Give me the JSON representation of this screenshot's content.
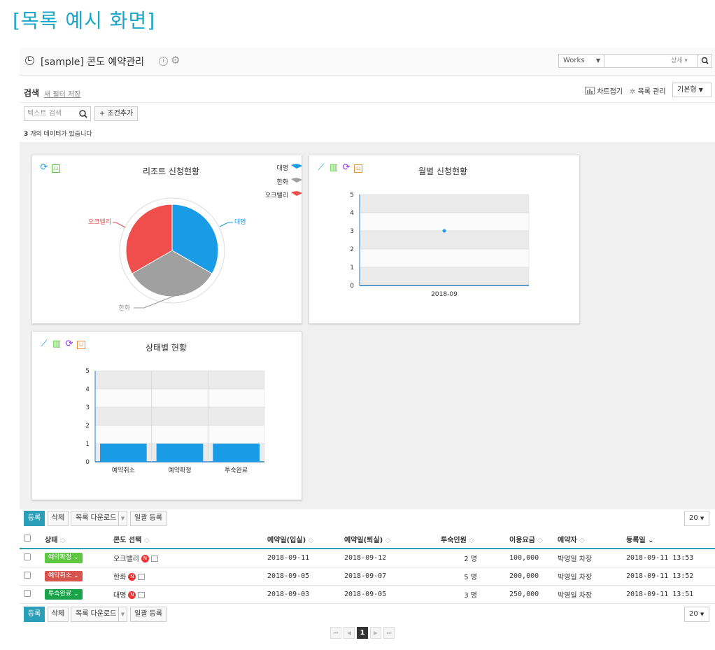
{
  "page_heading": "[목록 예시 화면]",
  "header": {
    "title": "[sample] 콘도 예약관리",
    "info_icon": "i",
    "works_select": "Works",
    "works_detail": "상세",
    "info_icon_name": "info-icon",
    "gear_icon_name": "gear-icon"
  },
  "search": {
    "label": "검색",
    "save_filter": "새 필터 저장",
    "chart_fold": "차트접기",
    "list_mgmt": "목록 관리",
    "view_select": "기본형",
    "text_placeholder": "텍스트 검색",
    "add_condition": "+ 조건추가",
    "count_num": "3",
    "count_text": " 개의 데이터가 있습니다"
  },
  "charts": {
    "pie": {
      "title": "리조트 신청현황",
      "legend": [
        "대명",
        "한화",
        "오크밸리"
      ],
      "labels": {
        "a": "대명",
        "b": "한화",
        "c": "오크밸리"
      }
    },
    "monthly": {
      "title": "월별 신청현황"
    },
    "status": {
      "title": "상태별 현황"
    }
  },
  "chart_data": [
    {
      "type": "pie",
      "title": "리조트 신청현황",
      "categories": [
        "대명",
        "한화",
        "오크밸리"
      ],
      "values": [
        1,
        1,
        1
      ],
      "colors": [
        "#1a9be6",
        "#a0a0a0",
        "#f04d4d"
      ]
    },
    {
      "type": "line",
      "title": "월별 신청현황",
      "x": [
        "2018-09"
      ],
      "values": [
        3
      ],
      "ylim": [
        0,
        5
      ],
      "yticks": [
        "0",
        "1",
        "2",
        "3",
        "4",
        "5"
      ]
    },
    {
      "type": "bar",
      "title": "상태별 현황",
      "categories": [
        "예약취소",
        "예약확정",
        "투숙완료"
      ],
      "values": [
        1,
        1,
        1
      ],
      "ylim": [
        0,
        5
      ],
      "yticks": [
        "0",
        "1",
        "2",
        "3",
        "4",
        "5"
      ],
      "color": "#1a9be6"
    }
  ],
  "toolbar": {
    "register": "등록",
    "delete": "삭제",
    "download": "목록 다운로드",
    "bulk": "일괄 등록",
    "page_size": "20"
  },
  "table": {
    "headers": [
      "상태",
      "콘도 선택",
      "예약일(입실)",
      "예약일(퇴실)",
      "투숙인원",
      "이용요금",
      "예약자",
      "등록일"
    ],
    "rows": [
      {
        "status": "예약확정",
        "status_color": "#5cc73f",
        "condo": "오크밸리",
        "checkin": "2018-09-11",
        "checkout": "2018-09-12",
        "guests": "2 명",
        "fee": "100,000",
        "booker": "박영일 차장",
        "registered": "2018-09-11 13:53"
      },
      {
        "status": "예약취소",
        "status_color": "#d9534f",
        "condo": "한화",
        "checkin": "2018-09-05",
        "checkout": "2018-09-07",
        "guests": "5 명",
        "fee": "200,000",
        "booker": "박영일 차장",
        "registered": "2018-09-11 13:52"
      },
      {
        "status": "투숙완료",
        "status_color": "#1aa34a",
        "condo": "대명",
        "checkin": "2018-09-03",
        "checkout": "2018-09-05",
        "guests": "3 명",
        "fee": "250,000",
        "booker": "박영일 차장",
        "registered": "2018-09-11 13:51"
      }
    ]
  },
  "pager": {
    "current": "1"
  }
}
